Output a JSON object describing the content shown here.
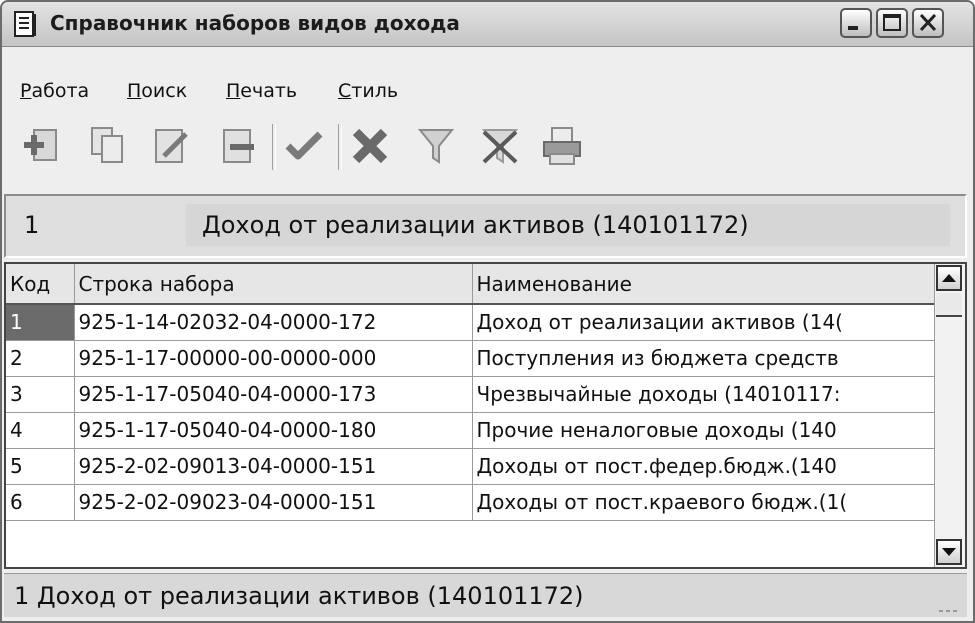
{
  "window": {
    "title": "Справочник наборов видов дохода",
    "buttons": [
      "minimize",
      "maximize",
      "close"
    ]
  },
  "menu": {
    "items": [
      {
        "accel": "Р",
        "rest": "абота"
      },
      {
        "accel": "П",
        "rest": "оиск"
      },
      {
        "accel": "П",
        "rest": "ечать"
      },
      {
        "accel": "С",
        "rest": "тиль"
      }
    ]
  },
  "toolbar": {
    "icons": [
      "add-record-icon",
      "copy-record-icon",
      "edit-record-icon",
      "delete-record-icon",
      "confirm-check-icon",
      "cancel-x-icon",
      "filter-funnel-icon",
      "clear-filter-icon",
      "print-icon"
    ]
  },
  "detail": {
    "code": "1",
    "name": "Доход от реализации активов (140101172)"
  },
  "grid": {
    "columns": [
      "Код",
      "Строка набора",
      "Наименование"
    ],
    "rows": [
      {
        "code": "1",
        "line": "925-1-14-02032-04-0000-172",
        "name": "Доход от реализации активов (14("
      },
      {
        "code": "2",
        "line": "925-1-17-00000-00-0000-000",
        "name": "Поступления из бюджета средств"
      },
      {
        "code": "3",
        "line": "925-1-17-05040-04-0000-173",
        "name": "Чрезвычайные доходы (14010117:"
      },
      {
        "code": "4",
        "line": "925-1-17-05040-04-0000-180",
        "name": "Прочие неналоговые доходы (140"
      },
      {
        "code": "5",
        "line": "925-2-02-09013-04-0000-151",
        "name": "Доходы от пост.федер.бюдж.(140"
      },
      {
        "code": "6",
        "line": "925-2-02-09023-04-0000-151",
        "name": "Доходы от пост.краевого бюдж.(1("
      }
    ],
    "selected_row": 0
  },
  "status": {
    "text": "1 Доход от реализации активов (140101172)"
  }
}
